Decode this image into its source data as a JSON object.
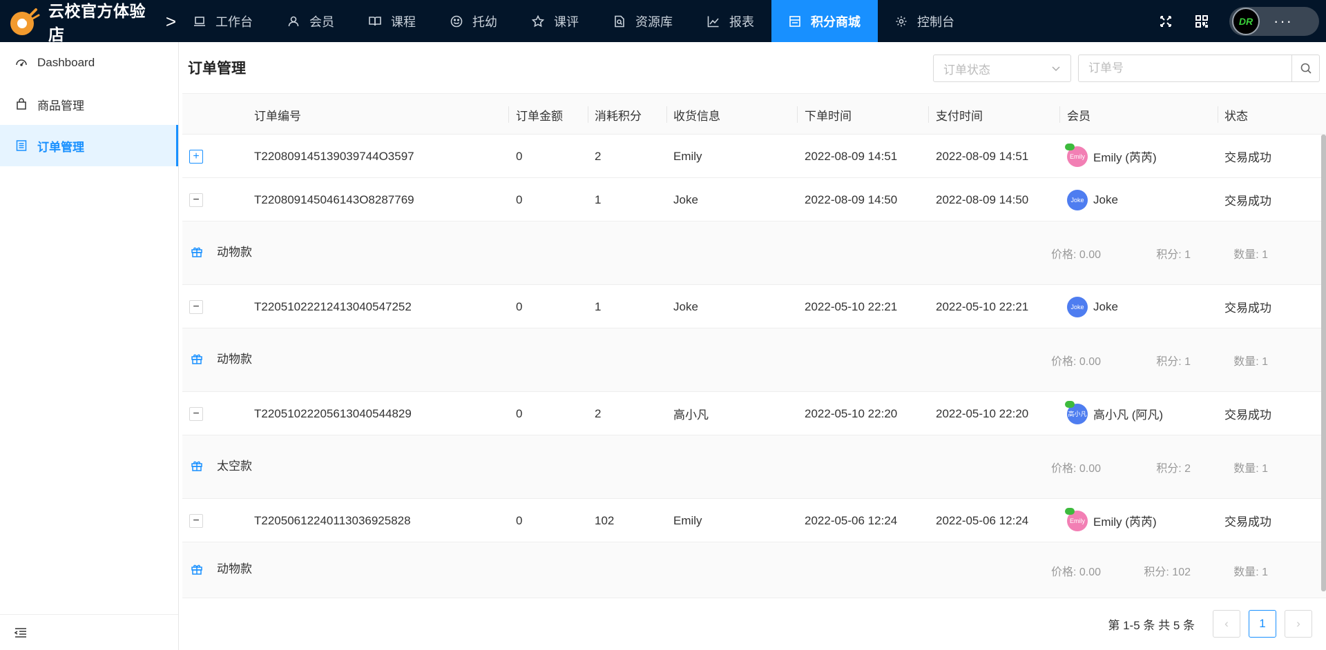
{
  "brand": {
    "name": "云校官方体验店",
    "chevron": ">"
  },
  "nav": [
    {
      "label": "工作台",
      "icon": "laptop-icon"
    },
    {
      "label": "会员",
      "icon": "user-icon"
    },
    {
      "label": "课程",
      "icon": "book-icon"
    },
    {
      "label": "托幼",
      "icon": "smile-icon"
    },
    {
      "label": "课评",
      "icon": "star-icon"
    },
    {
      "label": "资源库",
      "icon": "file-search-icon"
    },
    {
      "label": "报表",
      "icon": "chart-icon"
    },
    {
      "label": "积分商城",
      "icon": "shop-icon",
      "active": true
    },
    {
      "label": "控制台",
      "icon": "gear-icon"
    }
  ],
  "user": {
    "avatar_text": "DR",
    "more": "···"
  },
  "sidebar": {
    "items": [
      {
        "label": "Dashboard",
        "icon": "dashboard-icon"
      },
      {
        "label": "商品管理",
        "icon": "bag-icon"
      },
      {
        "label": "订单管理",
        "icon": "list-icon",
        "active": true
      }
    ]
  },
  "page": {
    "title": "订单管理"
  },
  "filters": {
    "status_placeholder": "订单状态",
    "order_no_placeholder": "订单号"
  },
  "table": {
    "headers": {
      "order_no": "订单编号",
      "amount": "订单金额",
      "points": "消耗积分",
      "receiver": "收货信息",
      "order_time": "下单时间",
      "pay_time": "支付时间",
      "member": "会员",
      "status": "状态"
    },
    "rows": [
      {
        "expander": "+",
        "order_no": "T220809145139039744O3597",
        "amount": "0",
        "points": "2",
        "receiver": "Emily",
        "order_time": "2022-08-09 14:51",
        "pay_time": "2022-08-09 14:51",
        "member": "Emily (芮芮)",
        "avatar_text": "Emily",
        "avatar_color": "#f27fb4",
        "wechat": true,
        "status": "交易成功",
        "detail": null
      },
      {
        "expander": "−",
        "order_no": "T220809145046143O8287769",
        "amount": "0",
        "points": "1",
        "receiver": "Joke",
        "order_time": "2022-08-09 14:50",
        "pay_time": "2022-08-09 14:50",
        "member": "Joke",
        "avatar_text": "Joke",
        "avatar_color": "#4e7df0",
        "wechat": false,
        "status": "交易成功",
        "detail": {
          "product": "动物款",
          "price": "价格: 0.00",
          "points": "积分: 1",
          "qty": "数量: 1"
        }
      },
      {
        "expander": "−",
        "order_no": "T220510222124130405472​52",
        "amount": "0",
        "points": "1",
        "receiver": "Joke",
        "order_time": "2022-05-10 22:21",
        "pay_time": "2022-05-10 22:21",
        "member": "Joke",
        "avatar_text": "Joke",
        "avatar_color": "#4e7df0",
        "wechat": false,
        "status": "交易成功",
        "detail": {
          "product": "动物款",
          "price": "价格: 0.00",
          "points": "积分: 1",
          "qty": "数量: 1"
        }
      },
      {
        "expander": "−",
        "order_no": "T220510222056130405448​29",
        "amount": "0",
        "points": "2",
        "receiver": "高小凡",
        "order_time": "2022-05-10 22:20",
        "pay_time": "2022-05-10 22:20",
        "member": "高小凡 (阿凡)",
        "avatar_text": "高小凡",
        "avatar_color": "#4e7df0",
        "wechat": true,
        "status": "交易成功",
        "detail": {
          "product": "太空款",
          "price": "价格: 0.00",
          "points": "积分: 2",
          "qty": "数量: 1"
        }
      },
      {
        "expander": "−",
        "order_no": "T220506122401130369258​28",
        "amount": "0",
        "points": "102",
        "receiver": "Emily",
        "order_time": "2022-05-06 12:24",
        "pay_time": "2022-05-06 12:24",
        "member": "Emily (芮芮)",
        "avatar_text": "Emily",
        "avatar_color": "#f27fb4",
        "wechat": true,
        "status": "交易成功",
        "detail": {
          "product": "动物款",
          "price": "价格: 0.00",
          "points": "积分: 102",
          "qty": "数量: 1"
        }
      }
    ]
  },
  "pagination": {
    "total_text": "第 1-5 条 共 5 条",
    "current": "1",
    "prev": "‹",
    "next": "›"
  }
}
